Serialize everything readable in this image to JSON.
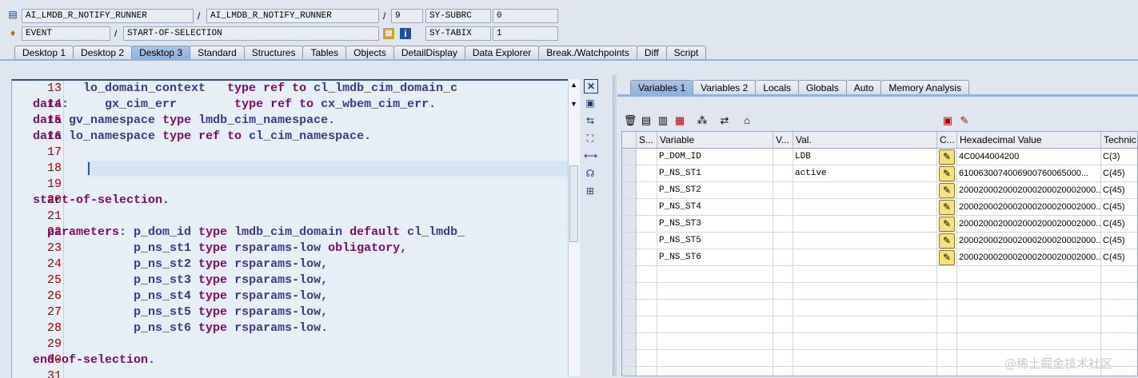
{
  "header": {
    "row1": {
      "program": "AI_LMDB_R_NOTIFY_RUNNER",
      "include": "AI_LMDB_R_NOTIFY_RUNNER",
      "line": "9",
      "sy_field": "SY-SUBRC",
      "sy_value": "0"
    },
    "row2": {
      "event_type": "EVENT",
      "event_name": "START-OF-SELECTION",
      "sy_field": "SY-TABIX",
      "sy_value": "1"
    },
    "slash": "/"
  },
  "tabs": [
    "Desktop 1",
    "Desktop 2",
    "Desktop 3",
    "Standard",
    "Structures",
    "Tables",
    "Objects",
    "DetailDisplay",
    "Data Explorer",
    "Break./Watchpoints",
    "Diff",
    "Script"
  ],
  "active_tab": "Desktop 3",
  "code": {
    "lines": [
      {
        "n": "13",
        "t": "         lo_domain_context   type ref to cl_lmdb_cim_domain_c"
      },
      {
        "n": "14",
        "t": "  data:     gx_cim_err        type ref to cx_wbem_cim_err."
      },
      {
        "n": "15",
        "t": "  data gv_namespace type lmdb_cim_namespace."
      },
      {
        "n": "16",
        "t": "  data lo_namespace type ref to cl_cim_namespace."
      },
      {
        "n": "17",
        "t": ""
      },
      {
        "n": "18",
        "t": ""
      },
      {
        "n": "19",
        "t": ""
      },
      {
        "n": "20",
        "t": "  start-of-selection."
      },
      {
        "n": "21",
        "t": ""
      },
      {
        "n": "22",
        "t": "    parameters: p_dom_id type lmdb_cim_domain default cl_lmdb_"
      },
      {
        "n": "23",
        "t": "                p_ns_st1 type rsparams-low obligatory,"
      },
      {
        "n": "24",
        "t": "                p_ns_st2 type rsparams-low,"
      },
      {
        "n": "25",
        "t": "                p_ns_st3 type rsparams-low,"
      },
      {
        "n": "26",
        "t": "                p_ns_st4 type rsparams-low,"
      },
      {
        "n": "27",
        "t": "                p_ns_st5 type rsparams-low,"
      },
      {
        "n": "28",
        "t": "                p_ns_st6 type rsparams-low."
      },
      {
        "n": "29",
        "t": ""
      },
      {
        "n": "30",
        "t": "  end-of-selection."
      },
      {
        "n": "31",
        "t": ""
      }
    ]
  },
  "right_tabs": [
    "Variables 1",
    "Variables 2",
    "Locals",
    "Globals",
    "Auto",
    "Memory Analysis"
  ],
  "right_active_tab": "Variables 1",
  "table": {
    "headers": [
      "S...",
      "Variable",
      "V...",
      "Val.",
      "C...",
      "Hexadecimal Value",
      "Technic"
    ],
    "rows": [
      {
        "var": "P_DOM_ID",
        "val": "LDB",
        "hex": "4C0044004200",
        "tech": "C(3)"
      },
      {
        "var": "P_NS_ST1",
        "val": "active",
        "hex": "6100630074006900760065000...",
        "tech": "C(45)"
      },
      {
        "var": "P_NS_ST2",
        "val": "",
        "hex": "2000200020002000200020002000...",
        "tech": "C(45)"
      },
      {
        "var": "P_NS_ST4",
        "val": "",
        "hex": "2000200020002000200020002000...",
        "tech": "C(45)"
      },
      {
        "var": "P_NS_ST3",
        "val": "",
        "hex": "2000200020002000200020002000...",
        "tech": "C(45)"
      },
      {
        "var": "P_NS_ST5",
        "val": "",
        "hex": "2000200020002000200020002000...",
        "tech": "C(45)"
      },
      {
        "var": "P_NS_ST6",
        "val": "",
        "hex": "2000200020002000200020002000...",
        "tech": "C(45)"
      }
    ]
  },
  "watermark": "@稀土掘金技术社区",
  "colors": {
    "keyword": "#7a0a6e",
    "code": "#3a3a8c",
    "line_number": "#b00000",
    "active_tab": "#8fb1dc"
  }
}
